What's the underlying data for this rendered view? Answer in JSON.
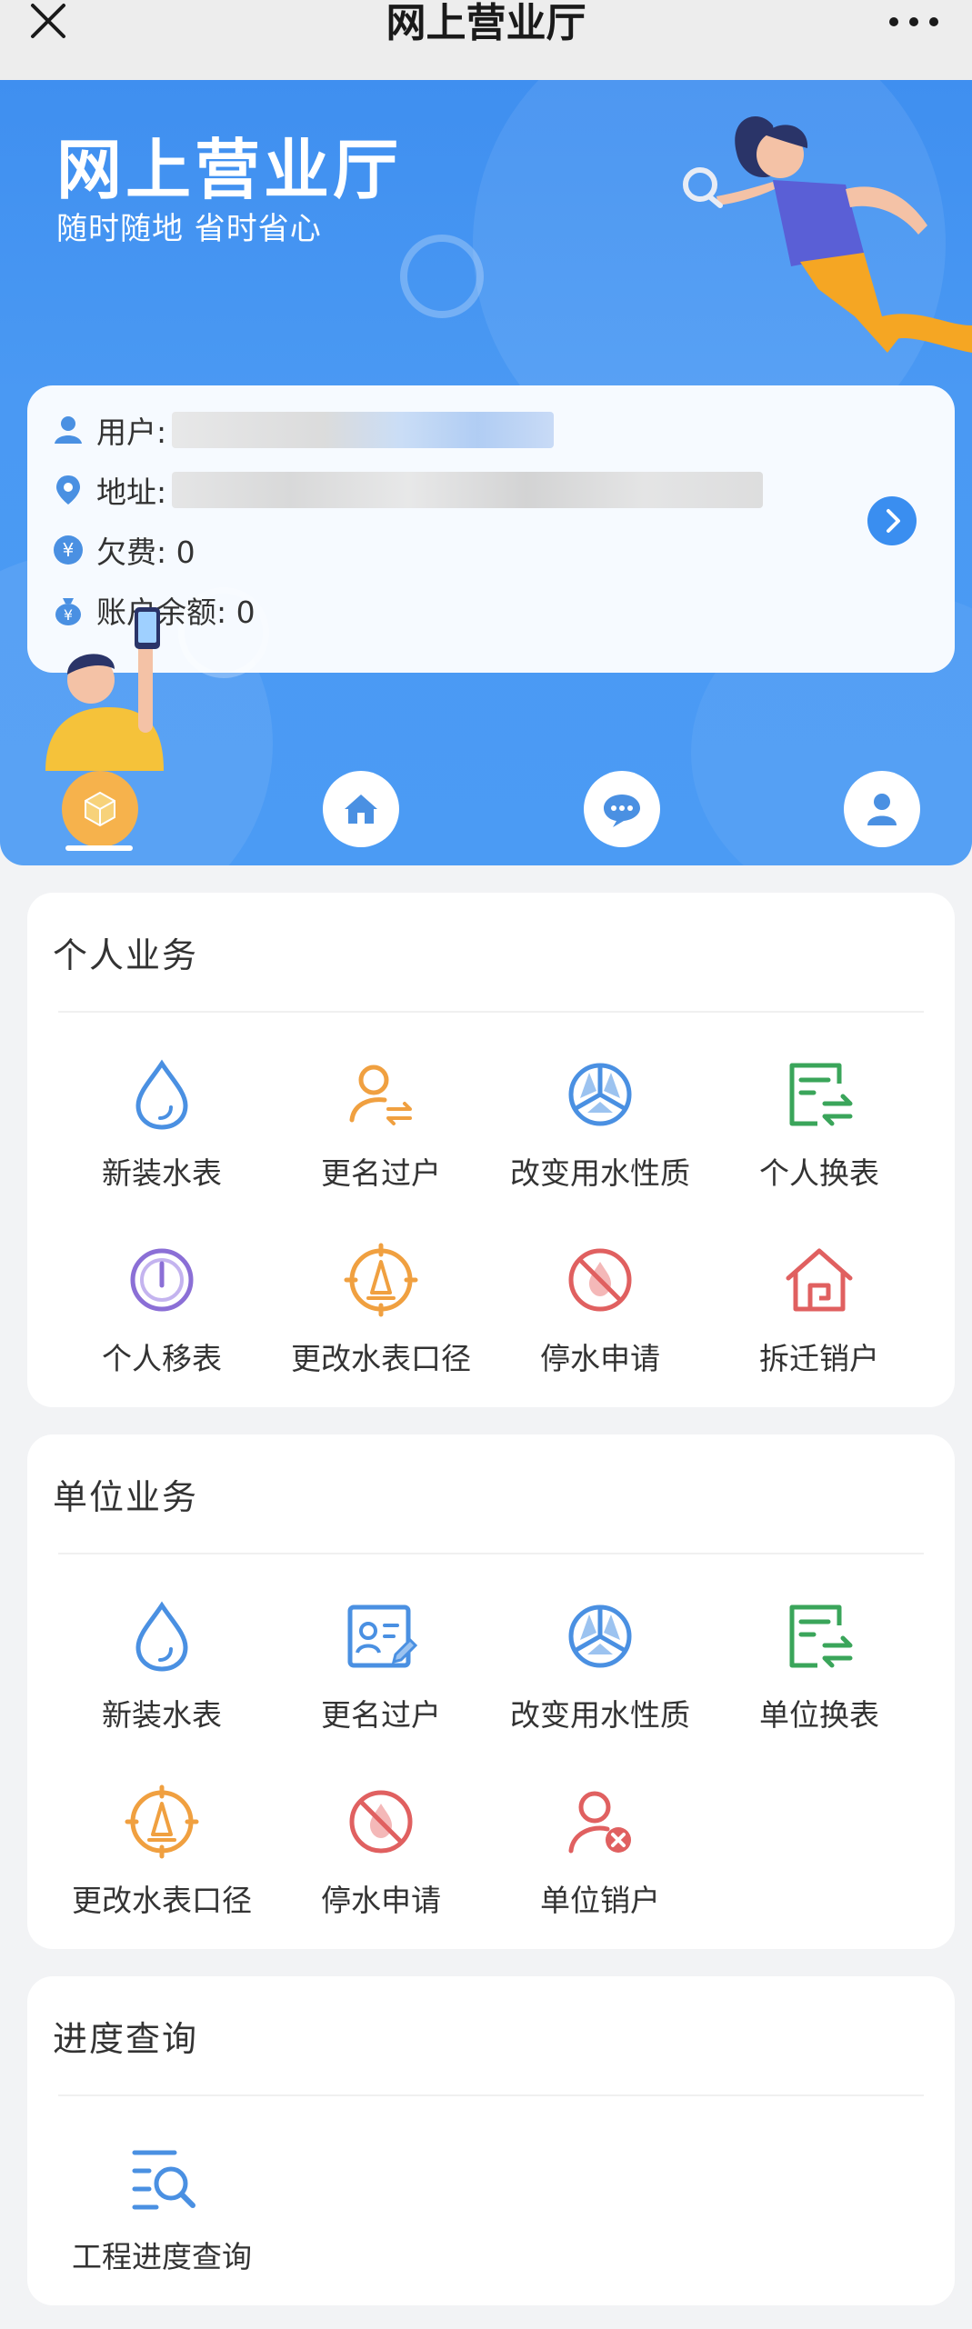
{
  "topbar": {
    "title": "网上营业厅"
  },
  "hero": {
    "title": "网上营业厅",
    "subtitle": "随时随地 省时省心"
  },
  "account": {
    "user_label": "用户:",
    "address_label": "地址:",
    "arrears_label": "欠费: 0",
    "balance_label": "账户余额: 0"
  },
  "tabs": [
    {
      "label": "业务办理",
      "active": true
    },
    {
      "label": "服务大厅",
      "active": false
    },
    {
      "label": "信息公告",
      "active": false
    },
    {
      "label": "个人中心",
      "active": false
    }
  ],
  "personal": {
    "title": "个人业务",
    "items": [
      {
        "label": "新装水表",
        "icon": "water-drop-icon"
      },
      {
        "label": "更名过户",
        "icon": "user-transfer-icon"
      },
      {
        "label": "改变用水性质",
        "icon": "pie-nature-icon"
      },
      {
        "label": "个人换表",
        "icon": "meter-swap-icon"
      },
      {
        "label": "个人移表",
        "icon": "gauge-icon"
      },
      {
        "label": "更改水表口径",
        "icon": "compass-dial-icon"
      },
      {
        "label": "停水申请",
        "icon": "no-water-icon"
      },
      {
        "label": "拆迁销户",
        "icon": "house-icon"
      }
    ]
  },
  "unit": {
    "title": "单位业务",
    "items": [
      {
        "label": "新装水表",
        "icon": "water-drop-icon"
      },
      {
        "label": "更名过户",
        "icon": "id-card-edit-icon"
      },
      {
        "label": "改变用水性质",
        "icon": "pie-nature-icon"
      },
      {
        "label": "单位换表",
        "icon": "meter-swap-icon"
      },
      {
        "label": "更改水表口径",
        "icon": "compass-dial-icon"
      },
      {
        "label": "停水申请",
        "icon": "no-water-icon"
      },
      {
        "label": "单位销户",
        "icon": "user-remove-icon"
      }
    ]
  },
  "progress": {
    "title": "进度查询",
    "items": [
      {
        "label": "工程进度查询",
        "icon": "search-list-icon"
      }
    ]
  },
  "colors": {
    "hero_blue": "#4a99f3",
    "accent_orange": "#f6b24c",
    "icon_blue": "#4a90e2",
    "icon_orange": "#f0a040",
    "icon_green": "#3aa55a",
    "icon_purple": "#8b6fd6",
    "icon_red": "#e06060"
  }
}
